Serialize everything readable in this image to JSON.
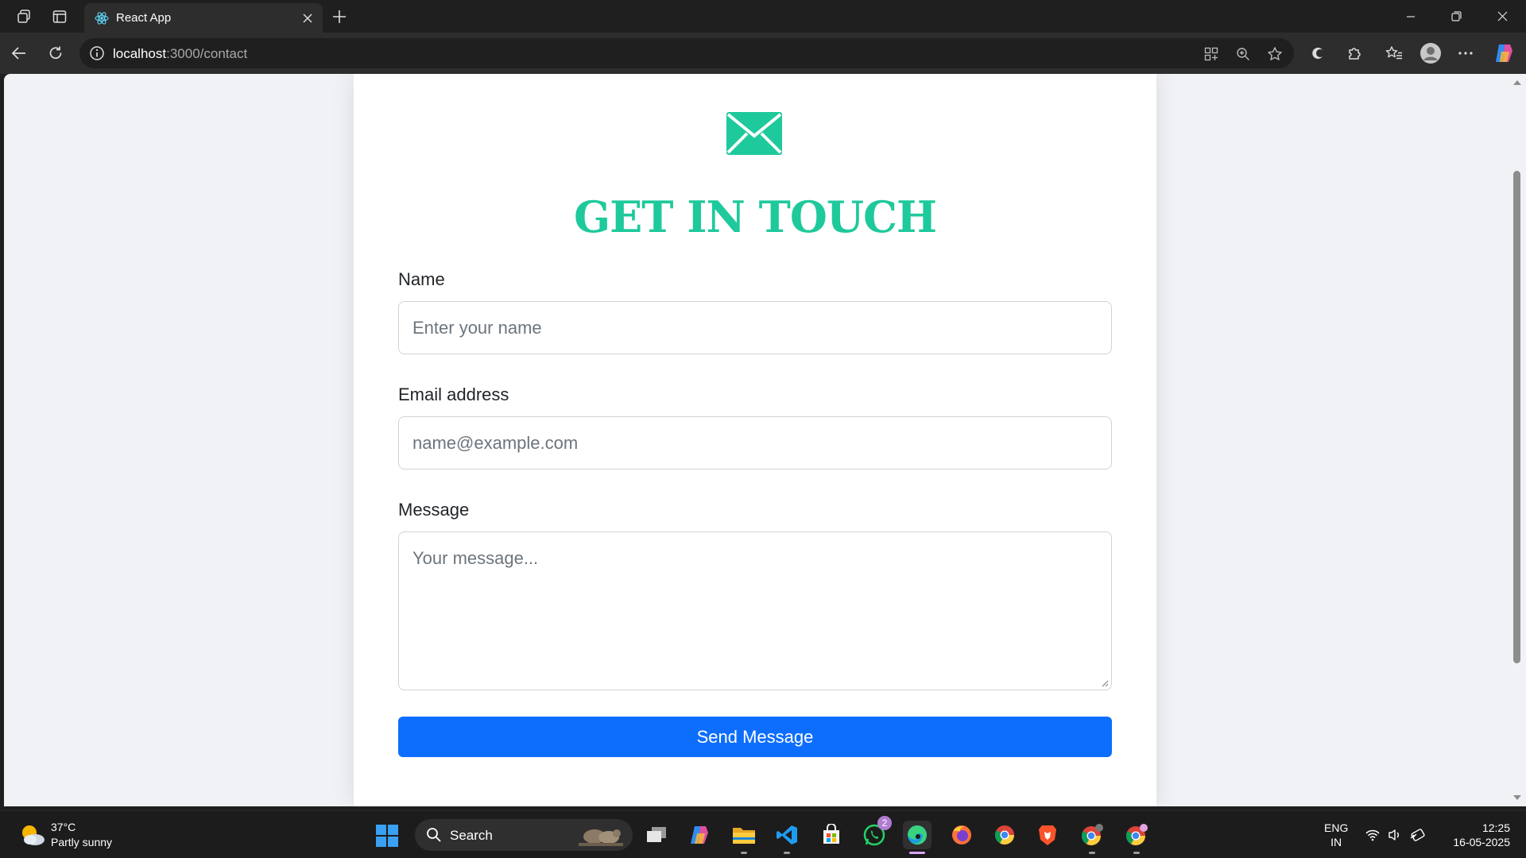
{
  "browser": {
    "tab_title": "React App",
    "url_host": "localhost",
    "url_rest": ":3000/contact"
  },
  "contact": {
    "heading": "GET IN TOUCH",
    "name_label": "Name",
    "name_placeholder": "Enter your name",
    "email_label": "Email address",
    "email_placeholder": "name@example.com",
    "message_label": "Message",
    "message_placeholder": "Your message...",
    "submit_label": "Send Message",
    "accent_color": "#1ec99b",
    "button_color": "#0d6efd"
  },
  "taskbar": {
    "weather_temp": "37°C",
    "weather_desc": "Partly sunny",
    "search_label": "Search",
    "whatsapp_badge": "2",
    "lang_line1": "ENG",
    "lang_line2": "IN",
    "time": "12:25",
    "date": "16-05-2025"
  }
}
